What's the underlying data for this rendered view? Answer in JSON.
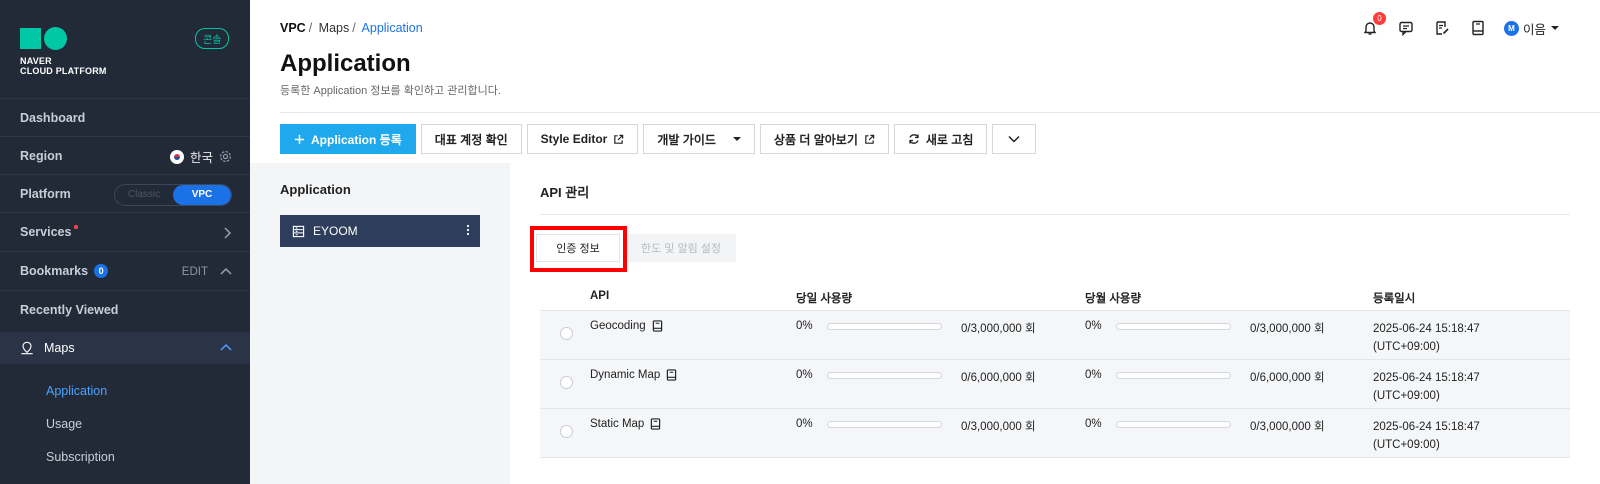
{
  "sidebar": {
    "logo_line1": "NAVER",
    "logo_line2": "CLOUD PLATFORM",
    "console_badge": "콘솔",
    "dashboard": "Dashboard",
    "region": {
      "label": "Region",
      "value": "한국"
    },
    "platform": {
      "label": "Platform",
      "options": [
        "Classic",
        "VPC"
      ],
      "selected": "VPC"
    },
    "services": "Services",
    "bookmarks": {
      "label": "Bookmarks",
      "count": "0",
      "edit": "EDIT"
    },
    "recently_viewed": "Recently Viewed",
    "maps": "Maps",
    "maps_items": [
      "Application",
      "Usage",
      "Subscription"
    ]
  },
  "header": {
    "breadcrumb": [
      "VPC",
      "Maps",
      "Application"
    ],
    "title": "Application",
    "subtitle": "등록한 Application 정보를 확인하고 관리합니다.",
    "notif_count": "0",
    "user_initial": "M",
    "user_name": "이음"
  },
  "toolbar": {
    "register": "Application 등록",
    "rep_account": "대표 계정 확인",
    "style_editor": "Style Editor",
    "dev_guide": "개발 가이드",
    "learn_more": "상품 더 알아보기",
    "refresh": "새로 고침"
  },
  "left_panel": {
    "title": "Application",
    "apps": [
      "EYOOM"
    ]
  },
  "main": {
    "title": "API 관리",
    "tabs": [
      "인증 정보",
      "한도 및 알림 설정"
    ],
    "active_tab": "인증 정보",
    "columns": [
      "API",
      "당일 사용량",
      "당월 사용량",
      "등록일시"
    ],
    "rows": [
      {
        "api": "Geocoding",
        "daily_pct": "0%",
        "daily_fraction": 0,
        "daily_limit": "0/3,000,000 회",
        "monthly_pct": "0%",
        "monthly_fraction": 0,
        "monthly_limit": "0/3,000,000 회",
        "date1": "2025-06-24 15:18:47",
        "date2": "(UTC+09:00)"
      },
      {
        "api": "Dynamic Map",
        "daily_pct": "0%",
        "daily_fraction": 0,
        "daily_limit": "0/6,000,000 회",
        "monthly_pct": "0%",
        "monthly_fraction": 0,
        "monthly_limit": "0/6,000,000 회",
        "date1": "2025-06-24 15:18:47",
        "date2": "(UTC+09:00)"
      },
      {
        "api": "Static Map",
        "daily_pct": "0%",
        "daily_fraction": 0,
        "daily_limit": "0/3,000,000 회",
        "monthly_pct": "0%",
        "monthly_fraction": 0,
        "monthly_limit": "0/3,000,000 회",
        "date1": "2025-06-24 15:18:47",
        "date2": "(UTC+09:00)"
      }
    ]
  },
  "colors": {
    "sidebar_bg": "#222a38",
    "accent": "#1b72e6",
    "primary_button": "#1fa9ec",
    "logo": "#00c7a5",
    "highlight": "#ff0000"
  }
}
